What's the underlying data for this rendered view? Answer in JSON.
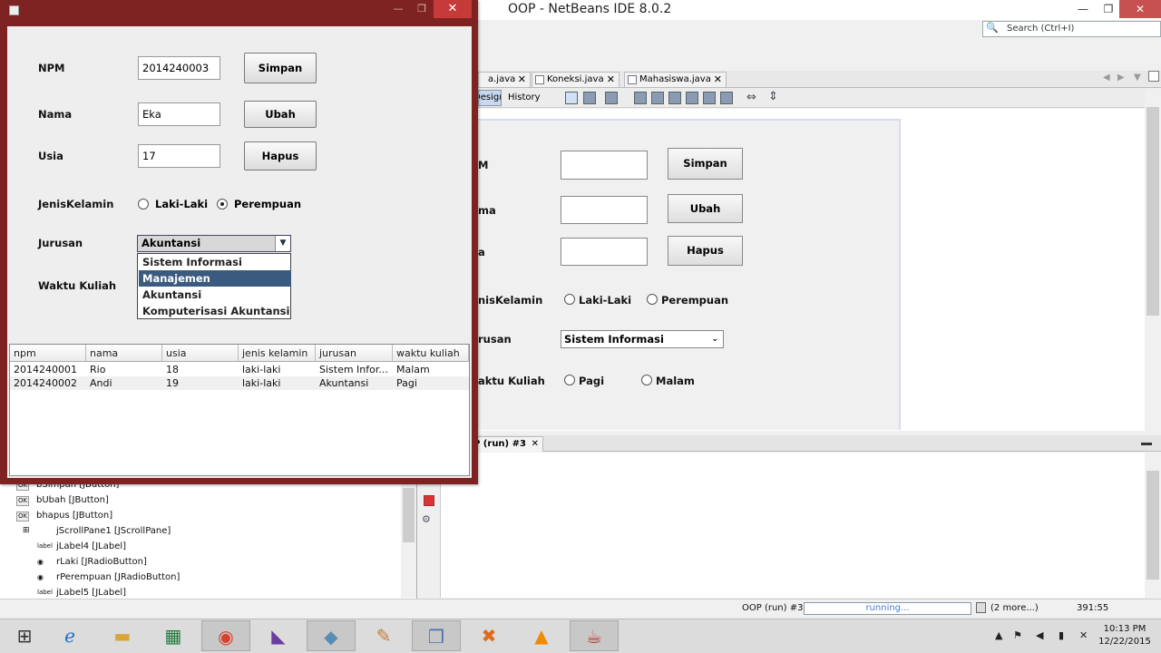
{
  "ide": {
    "title": "OOP - NetBeans IDE 8.0.2",
    "search_placeholder": "Search (Ctrl+I)",
    "window_controls": {
      "min": "—",
      "max": "❐",
      "close": "✕"
    },
    "editor_tabs": [
      {
        "label": "a.java"
      },
      {
        "label": "Koneksi.java"
      },
      {
        "label": "Mahasiswa.java"
      }
    ],
    "view_toggle": {
      "design": "Design",
      "history": "History"
    },
    "designer": {
      "labels": [
        "M",
        "ma",
        "a",
        "nisKelamin",
        "rusan",
        "aktu Kuliah"
      ],
      "buttons": [
        "Simpan",
        "Ubah",
        "Hapus"
      ],
      "gender_options": [
        "Laki-Laki",
        "Perempuan"
      ],
      "jurusan_value": "Sistem Informasi",
      "waktu_options": [
        "Pagi",
        "Malam"
      ]
    },
    "output_tab": "P (run) #3",
    "navigator_items": [
      {
        "icon": "OK",
        "label": "bSimpan [JButton]"
      },
      {
        "icon": "OK",
        "label": "bUbah [JButton]"
      },
      {
        "icon": "OK",
        "label": "bhapus [JButton]"
      },
      {
        "icon": "⊞",
        "label": "jScrollPane1 [JScrollPane]"
      },
      {
        "icon": "label",
        "label": "jLabel4 [JLabel]"
      },
      {
        "icon": "◉",
        "label": "rLaki [JRadioButton]"
      },
      {
        "icon": "◉",
        "label": "rPerempuan [JRadioButton]"
      },
      {
        "icon": "label",
        "label": "jLabel5 [JLabel]"
      }
    ],
    "status": {
      "task_name": "OOP (run) #3",
      "progress_text": "running...",
      "more_tasks": "(2 more...)",
      "caret_pos": "391:55"
    }
  },
  "app": {
    "form": {
      "npm_label": "NPM",
      "nama_label": "Nama",
      "usia_label": "Usia",
      "jenis_label": "JenisKelamin",
      "jurusan_label": "Jurusan",
      "waktu_label": "Waktu Kuliah",
      "npm_value": "2014240003",
      "nama_value": "Eka",
      "usia_value": "17",
      "simpan": "Simpan",
      "ubah": "Ubah",
      "hapus": "Hapus",
      "laki": "Laki-Laki",
      "perempuan": "Perempuan",
      "gender_selected": "Perempuan",
      "jurusan_selected": "Akuntansi",
      "jurusan_options": [
        "Sistem Informasi",
        "Manajemen",
        "Akuntansi",
        "Komputerisasi Akuntansi"
      ],
      "jurusan_highlighted": "Manajemen"
    },
    "table": {
      "columns": [
        "npm",
        "nama",
        "usia",
        "jenis kelamin",
        "jurusan",
        "waktu kuliah"
      ],
      "rows": [
        [
          "2014240001",
          "Rio",
          "18",
          "laki-laki",
          "Sistem Infor...",
          "Malam"
        ],
        [
          "2014240002",
          "Andi",
          "19",
          "laki-laki",
          "Akuntansi",
          "Pagi"
        ]
      ]
    }
  },
  "taskbar": {
    "time": "10:13 PM",
    "date": "12/22/2015"
  }
}
